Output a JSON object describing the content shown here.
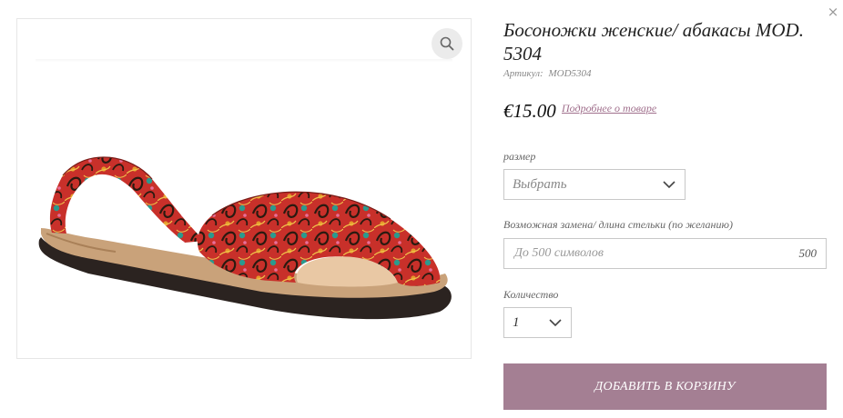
{
  "modal": {
    "close_label": "×"
  },
  "gallery": {
    "zoom_icon": "search-icon",
    "image_alt": "women's printed avarca sandal"
  },
  "product": {
    "title": "Босоножки женские/ абакасы MOD. 5304",
    "sku_label": "Артикул:",
    "sku_value": "MOD5304",
    "price": "€15.00",
    "details_link": "Подробнее о товаре"
  },
  "options": {
    "size_label": "размер",
    "size_value": "Выбрать",
    "note_label": "Возможная замена/ длина стельки (по желанию)",
    "note_placeholder": "До 500 символов",
    "note_counter": "500",
    "qty_label": "Количество",
    "qty_value": "1"
  },
  "actions": {
    "add_to_cart": "ДОБАВИТЬ В КОРЗИНУ"
  },
  "colors": {
    "accent": "#a47f93",
    "link": "#a06f8c"
  }
}
